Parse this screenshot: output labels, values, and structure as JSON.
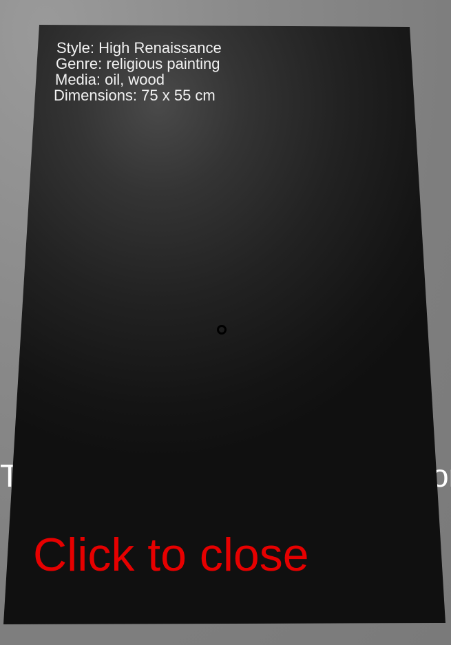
{
  "background": {
    "left_fragment": "Th",
    "right_fragment": "on"
  },
  "info_panel": {
    "style": "Style: High Renaissance",
    "genre": "Genre: religious painting",
    "media": "Media: oil, wood",
    "dimensions": "Dimensions: 75 x 55 cm",
    "close_label": "Click to close"
  },
  "colors": {
    "panel": "#141414",
    "close_text": "#e60000",
    "info_text": "#f2f2f2",
    "background": "#8a8a8a"
  },
  "crosshair": {
    "icon": "crosshair-ring-icon"
  }
}
